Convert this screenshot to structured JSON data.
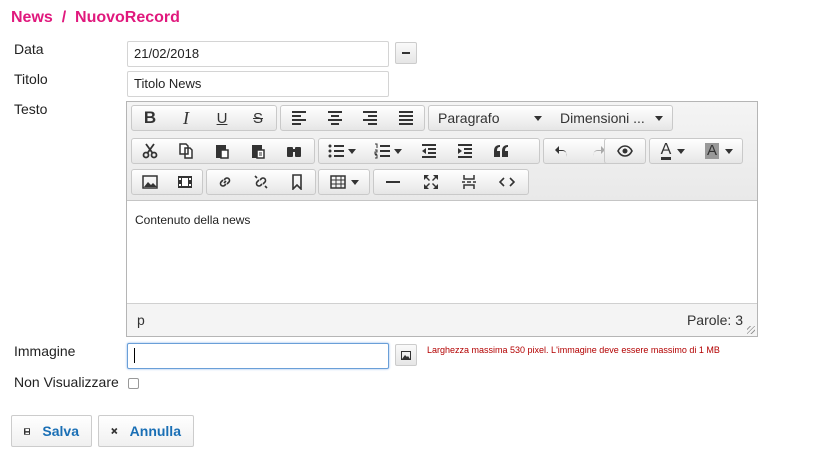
{
  "breadcrumb": {
    "root": "News",
    "sep": "/",
    "current": "NuovoRecord"
  },
  "fields": {
    "data_label": "Data",
    "data_value": "21/02/2018",
    "titolo_label": "Titolo",
    "titolo_value": "Titolo News",
    "testo_label": "Testo",
    "immagine_label": "Immagine",
    "immagine_value": "",
    "immagine_hint": "Larghezza massima 530 pixel. L'immagine deve essere massimo di 1 MB",
    "non_visualizzare_label": "Non Visualizzare"
  },
  "editor": {
    "format_select": "Paragrafo",
    "size_select": "Dimensioni ...",
    "content": "Contenuto della news",
    "status_path": "p",
    "word_count": "Parole: 3",
    "icons": [
      "bold-icon",
      "italic-icon",
      "underline-icon",
      "strikethrough-icon",
      "align-left-icon",
      "align-center-icon",
      "align-right-icon",
      "align-justify-icon",
      "cut-icon",
      "copy-icon",
      "paste-icon",
      "paste-text-icon",
      "find-icon",
      "bulleted-list-icon",
      "numbered-list-icon",
      "outdent-icon",
      "indent-icon",
      "blockquote-icon",
      "undo-icon",
      "redo-icon",
      "preview-icon",
      "text-color-icon",
      "background-color-icon",
      "image-icon",
      "media-icon",
      "link-icon",
      "unlink-icon",
      "anchor-icon",
      "table-icon",
      "horizontal-rule-icon",
      "fullscreen-icon",
      "page-break-icon",
      "source-code-icon"
    ],
    "bold": "B",
    "italic": "I",
    "underline": "U",
    "strike": "S",
    "color_a": "A",
    "bg_a": "A"
  },
  "actions": {
    "save": "Salva",
    "cancel": "Annulla"
  },
  "colors": {
    "brand": "#e0197d",
    "link": "#1a6fb5",
    "hint": "#b30000"
  }
}
